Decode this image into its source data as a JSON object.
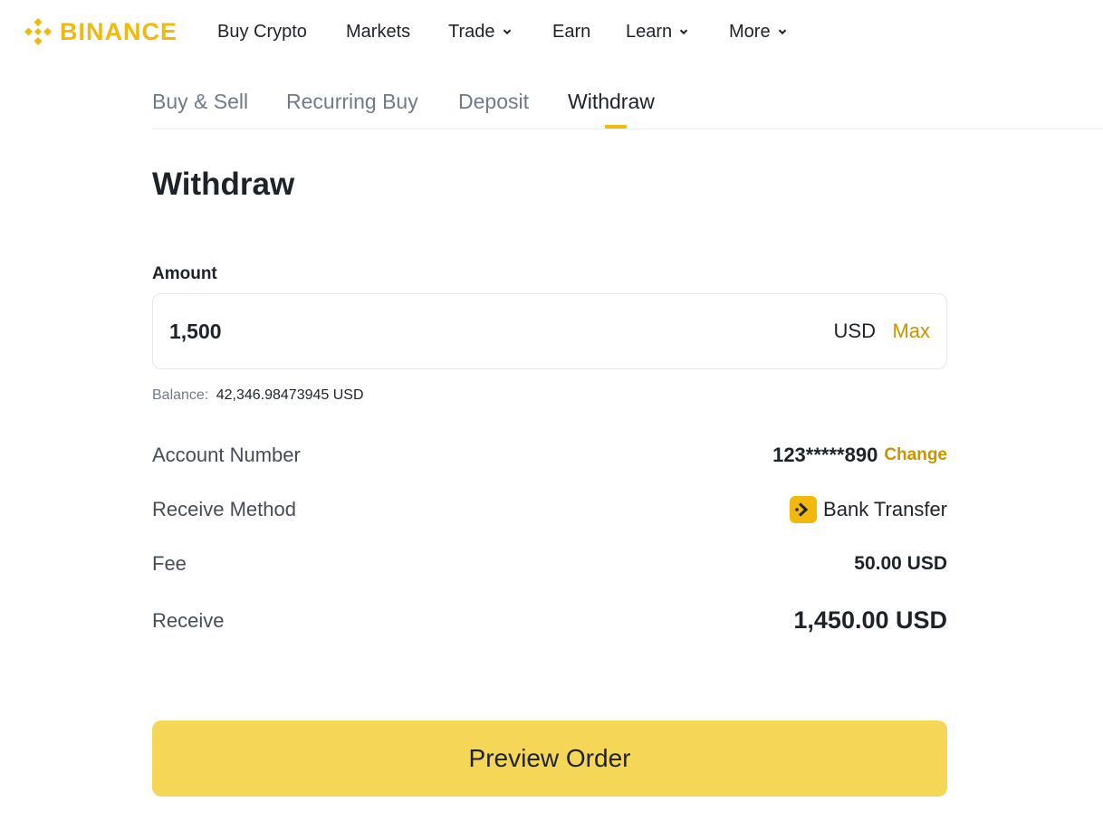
{
  "brand": {
    "name": "BINANCE",
    "accent": "#f0b90b"
  },
  "nav": {
    "items": [
      {
        "label": "Buy Crypto",
        "has_dropdown": false
      },
      {
        "label": "Markets",
        "has_dropdown": false
      },
      {
        "label": "Trade",
        "has_dropdown": true
      },
      {
        "label": "Earn",
        "has_dropdown": false
      },
      {
        "label": "Learn",
        "has_dropdown": true
      },
      {
        "label": "More",
        "has_dropdown": true
      }
    ]
  },
  "tabs": {
    "items": [
      "Buy & Sell",
      "Recurring Buy",
      "Deposit",
      "Withdraw"
    ],
    "active": "Withdraw"
  },
  "page_title": "Withdraw",
  "amount": {
    "label": "Amount",
    "value": "1,500",
    "currency": "USD",
    "max_label": "Max"
  },
  "balance": {
    "label": "Balance:",
    "value": "42,346.98473945 USD"
  },
  "details": {
    "account": {
      "label": "Account Number",
      "value": "123*****890",
      "action": "Change"
    },
    "method": {
      "label": "Receive Method",
      "value": "Bank Transfer",
      "icon": "bank-transfer-icon"
    },
    "fee": {
      "label": "Fee",
      "value": "50.00 USD"
    },
    "receive": {
      "label": "Receive",
      "value": "1,450.00 USD"
    }
  },
  "preview_button": "Preview Order",
  "colors": {
    "link": "#c99400",
    "button": "#f5d656",
    "text": "#1e2329",
    "muted": "#707a8a"
  }
}
